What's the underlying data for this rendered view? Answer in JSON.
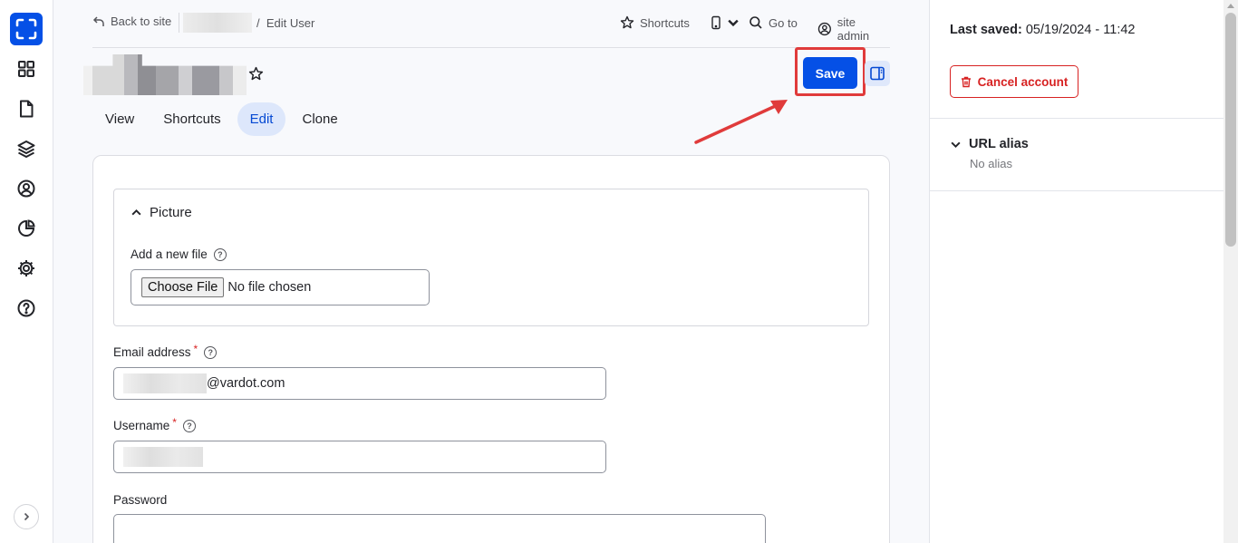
{
  "topbar": {
    "back_label": "Back to site",
    "current_page": "Edit User",
    "shortcuts_label": "Shortcuts",
    "goto_label": "Go to",
    "user_label": "site admin"
  },
  "actions": {
    "save_label": "Save"
  },
  "tabs": [
    {
      "label": "View"
    },
    {
      "label": "Shortcuts"
    },
    {
      "label": "Edit"
    },
    {
      "label": "Clone"
    }
  ],
  "form": {
    "picture_legend": "Picture",
    "add_file_label": "Add a new file",
    "choose_file_label": "Choose File",
    "no_file_text": "No file chosen",
    "email_label": "Email address",
    "email_value_suffix": "@vardot.com",
    "username_label": "Username",
    "password_label": "Password",
    "required_mark": "*",
    "help_glyph": "?"
  },
  "sidebar": {
    "last_saved_label": "Last saved:",
    "last_saved_value": "05/19/2024 - 11:42",
    "cancel_account_label": "Cancel account",
    "url_alias_label": "URL alias",
    "url_alias_value": "No alias"
  },
  "colors": {
    "accent": "#0550e6",
    "danger": "#d72222",
    "highlight": "#e03b3b"
  }
}
